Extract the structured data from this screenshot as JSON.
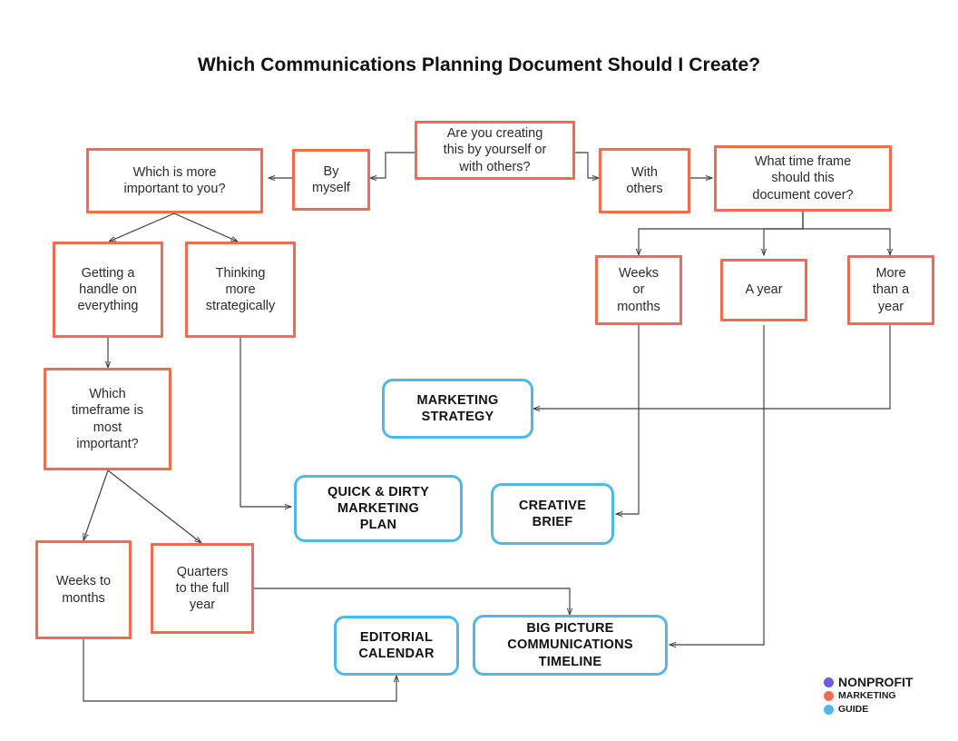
{
  "title": "Which Communications Planning Document Should I Create?",
  "colors": {
    "question_border": "#ef6b52",
    "outcome_border": "#4fb8e8",
    "connector": "#3c3c3c",
    "text": "#2b2b2b",
    "background": "#ffffff",
    "logo_dot_purple": "#6f5ae0",
    "logo_dot_coral": "#ef6b52",
    "logo_dot_blue": "#4fb8e8"
  },
  "nodes": {
    "start_question": "Are you creating\nthis by yourself or\nwith others?",
    "by_myself": "By\nmyself",
    "with_others": "With\nothers",
    "which_is_more_important": "Which is more\nimportant to you?",
    "what_time_frame": "What time frame\nshould this\ndocument cover?",
    "getting_a_handle": "Getting a\nhandle on\neverything",
    "thinking_strategically": "Thinking\nmore\nstrategically",
    "weeks_or_months": "Weeks\nor\nmonths",
    "a_year": "A year",
    "more_than_a_year": "More\nthan a\nyear",
    "which_timeframe": "Which\ntimeframe is\nmost\nimportant?",
    "weeks_to_months": "Weeks to\nmonths",
    "quarters_to_full_year": "Quarters\nto the full\nyear",
    "marketing_strategy": "MARKETING\nSTRATEGY",
    "quick_and_dirty": "QUICK & DIRTY\nMARKETING\nPLAN",
    "creative_brief": "CREATIVE\nBRIEF",
    "editorial_calendar": "EDITORIAL\nCALENDAR",
    "big_picture_timeline": "BIG PICTURE\nCOMMUNICATIONS\nTIMELINE"
  },
  "logo": {
    "line1": "NONPROFIT",
    "line2": "MARKETING",
    "line3": "GUIDE"
  }
}
